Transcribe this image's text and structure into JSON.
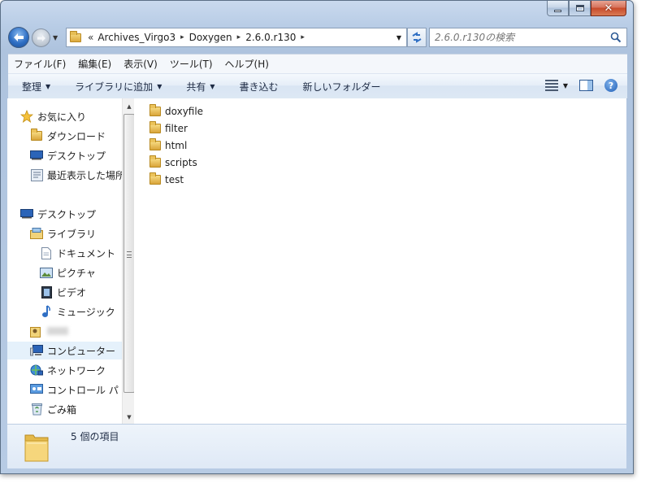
{
  "window": {
    "caption_buttons": {
      "minimize": "minimize",
      "maximize": "maximize",
      "close": "✕"
    }
  },
  "navigation": {
    "overflow_marker": "«",
    "breadcrumb": [
      "Archives_Virgo3",
      "Doxygen",
      "2.6.0.r130"
    ],
    "separator": "▸"
  },
  "search": {
    "placeholder": "2.6.0.r130の検索"
  },
  "menubar": {
    "items": [
      "ファイル(F)",
      "編集(E)",
      "表示(V)",
      "ツール(T)",
      "ヘルプ(H)"
    ]
  },
  "toolbar": {
    "organize": "整理",
    "add_to_library": "ライブラリに追加",
    "share": "共有",
    "burn": "書き込む",
    "new_folder": "新しいフォルダー"
  },
  "navpane": {
    "favorites": "お気に入り",
    "downloads": "ダウンロード",
    "desktop_fav": "デスクトップ",
    "recent": "最近表示した場所",
    "desktop": "デスクトップ",
    "libraries": "ライブラリ",
    "documents": "ドキュメント",
    "pictures": "ピクチャ",
    "videos": "ビデオ",
    "music": "ミュージック",
    "computer": "コンピューター",
    "network": "ネットワーク",
    "control_panel": "コントロール パ",
    "recycle_bin": "ごみ箱"
  },
  "files": [
    "doxyfile",
    "filter",
    "html",
    "scripts",
    "test"
  ],
  "details": {
    "item_count": "5 個の項目"
  },
  "colors": {
    "accent": "#2f6fc4",
    "frame": "#b9cde6",
    "selection": "#e5f1fb",
    "folder": "#e6bd55"
  }
}
